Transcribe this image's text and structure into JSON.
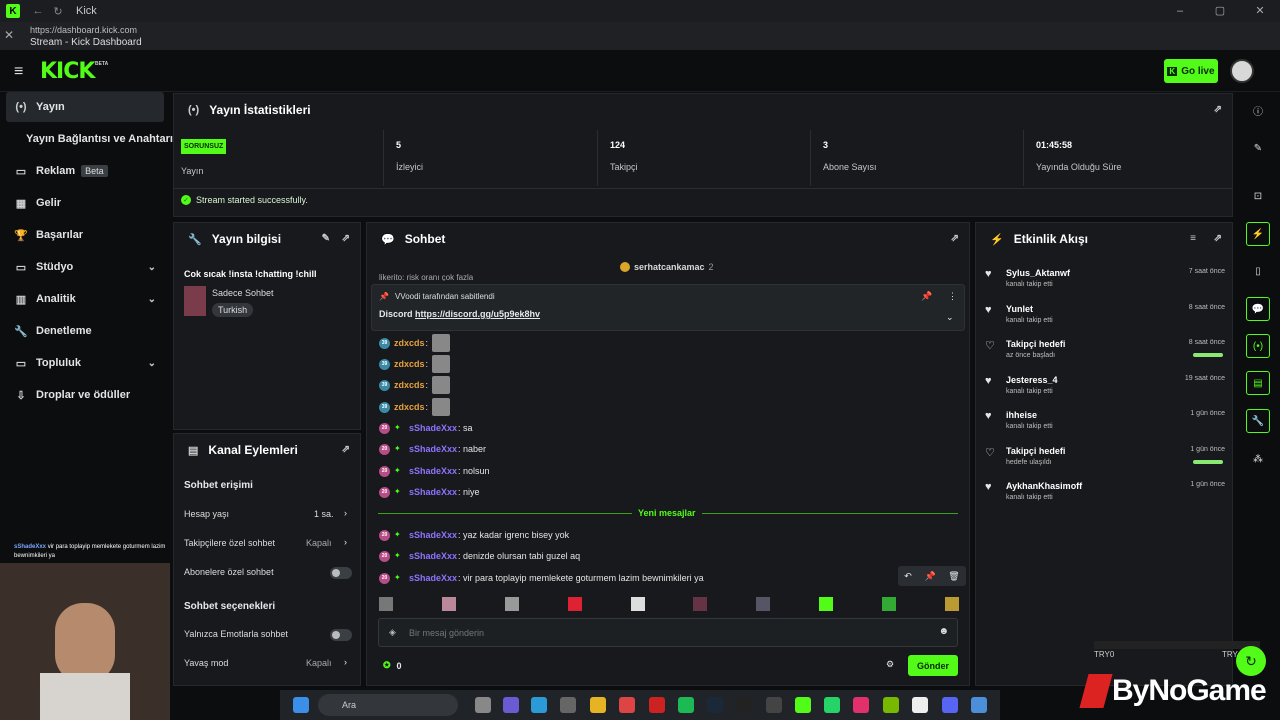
{
  "window": {
    "title": "Kick",
    "url": "https://dashboard.kick.com",
    "page_title": "Stream - Kick Dashboard"
  },
  "header": {
    "logo": "KICK",
    "beta": "BETA",
    "go_live": "Go live"
  },
  "sidebar": {
    "items": [
      {
        "label": "Yayın",
        "icon": "(•)"
      },
      {
        "label": "Yayın Bağlantısı ve Anahtarı",
        "icon": ""
      },
      {
        "label": "Reklam",
        "icon": "▭",
        "badge": "Beta"
      },
      {
        "label": "Gelir",
        "icon": "▦"
      },
      {
        "label": "Başarılar",
        "icon": "🏆"
      },
      {
        "label": "Stüdyo",
        "icon": "▭"
      },
      {
        "label": "Analitik",
        "icon": "▥"
      },
      {
        "label": "Denetleme",
        "icon": "🔧"
      },
      {
        "label": "Topluluk",
        "icon": "▭"
      },
      {
        "label": "Droplar ve ödüller",
        "icon": "⇩"
      }
    ]
  },
  "stats": {
    "title": "Yayın İstatistikleri",
    "status_badge": "SORUNSUZ",
    "status_label": "Yayın",
    "viewers": "5",
    "viewers_label": "İzleyici",
    "followers": "124",
    "followers_label": "Takipçi",
    "subs": "3",
    "subs_label": "Abone Sayısı",
    "uptime": "01:45:58",
    "uptime_label": "Yayında Olduğu Süre",
    "success": "Stream started successfully."
  },
  "info": {
    "title": "Yayın bilgisi",
    "stream_title": "Cok sıcak !insta !chatting !chill",
    "category": "Sadece Sohbet",
    "tag": "Turkish"
  },
  "channel": {
    "title": "Kanal Eylemleri",
    "chat_access": "Sohbet erişimi",
    "account_age": "Hesap yaşı",
    "account_age_value": "1 sa.",
    "followers_only": "Takipçilere özel sohbet",
    "followers_only_value": "Kapalı",
    "subs_only": "Abonelere özel sohbet",
    "chat_options": "Sohbet seçenekleri",
    "emote_only": "Yalnızca Emotlarla sohbet",
    "slow_mode": "Yavaş mod",
    "slow_mode_value": "Kapalı"
  },
  "chat": {
    "title": "Sohbet",
    "top_user": "serhatcankamac",
    "top_count": "2",
    "partial": "likerito: risk oranı çok fazla",
    "pinned_by": "VVoodi tarafından sabitlendi",
    "pinned_label": "Discord",
    "pinned_link": "https://discord.gg/u5p9ek8hv",
    "messages": [
      {
        "badge": "39",
        "user": "zdxcds",
        "text": ":"
      },
      {
        "badge": "39",
        "user": "zdxcds",
        "text": ":"
      },
      {
        "badge": "39",
        "user": "zdxcds",
        "text": ":"
      },
      {
        "badge": "39",
        "user": "zdxcds",
        "text": ":"
      },
      {
        "badge": "20",
        "user": "sShadeXxx",
        "text": ": sa"
      },
      {
        "badge": "20",
        "user": "sShadeXxx",
        "text": ": naber"
      },
      {
        "badge": "20",
        "user": "sShadeXxx",
        "text": ": nolsun"
      },
      {
        "badge": "20",
        "user": "sShadeXxx",
        "text": ": niye"
      }
    ],
    "new_messages": "Yeni mesajlar",
    "new": [
      {
        "badge": "20",
        "user": "sShadeXxx",
        "text": ": yaz kadar igrenc bisey yok"
      },
      {
        "badge": "20",
        "user": "sShadeXxx",
        "text": ": denizde olursan tabi guzel aq"
      },
      {
        "badge": "20",
        "user": "sShadeXxx",
        "text": ": vir para toplayip memlekete goturmem lazim bewnimkileri ya"
      }
    ],
    "input_placeholder": "Bir mesaj gönderin",
    "points": "0",
    "send": "Gönder"
  },
  "activity": {
    "title": "Etkinlik Akışı",
    "items": [
      {
        "name": "Sylus_Aktanwf",
        "sub": "kanalı takip etti",
        "time": "7 saat önce"
      },
      {
        "name": "Yunlet",
        "sub": "kanalı takip etti",
        "time": "8 saat önce"
      },
      {
        "name": "Takipçi hedefi",
        "sub": "az önce başladı",
        "time": "8 saat önce",
        "bar": true
      },
      {
        "name": "Jesteress_4",
        "sub": "kanalı takip etti",
        "time": "19 saat önce"
      },
      {
        "name": "ihheise",
        "sub": "kanalı takip etti",
        "time": "1 gün önce"
      },
      {
        "name": "Takipçi hedefi",
        "sub": "hedefe ulaşıldı",
        "time": "1 gün önce",
        "bar": true
      },
      {
        "name": "AykhanKhasimoff",
        "sub": "kanalı takip etti",
        "time": "1 gün önce"
      }
    ]
  },
  "overlay": {
    "chat_user": "sShadeXxx",
    "chat_text": "vir para toplayip memlekete goturmem lazim bewnimkileri ya",
    "brand": "ByNoGame",
    "ticker_a": "TRY0",
    "ticker_b": "TRY"
  },
  "taskbar": {
    "search": "Ara"
  },
  "colors": {
    "accent": "#53fc18",
    "bg": "#0b0d0e",
    "panel": "#17191c"
  }
}
